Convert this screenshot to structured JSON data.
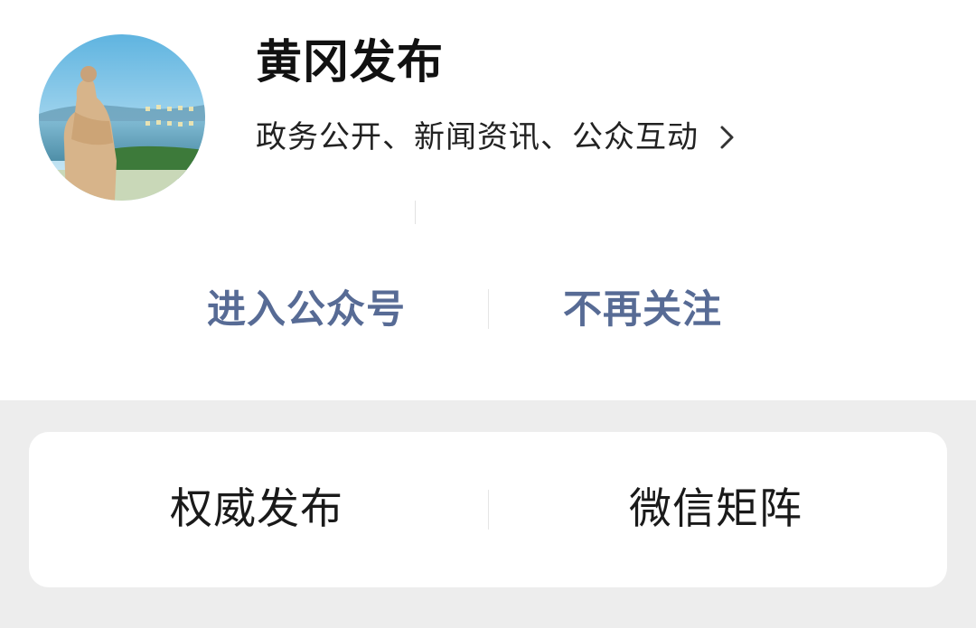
{
  "account": {
    "name": "黄冈发布",
    "description": "政务公开、新闻资讯、公众互动",
    "avatar_icon": "statue-lake-avatar"
  },
  "actions": {
    "enter_label": "进入公众号",
    "unfollow_label": "不再关注",
    "link_color": "#576b95"
  },
  "menu": {
    "items": [
      {
        "label": "权威发布"
      },
      {
        "label": "微信矩阵"
      }
    ]
  },
  "colors": {
    "page_background": "#ededed",
    "card_background": "#ffffff"
  }
}
